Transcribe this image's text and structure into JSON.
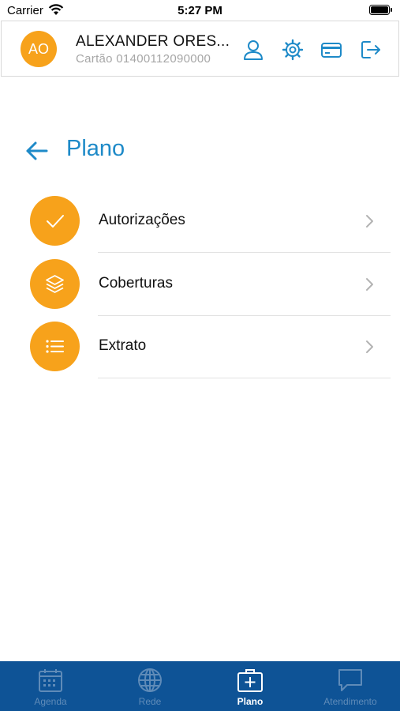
{
  "status_bar": {
    "carrier": "Carrier",
    "time": "5:27 PM"
  },
  "header": {
    "avatar_initials": "AO",
    "user_name": "ALEXANDER ORES...",
    "card_text": "Cartão 01400112090000",
    "icons": [
      "user-icon",
      "settings-icon",
      "card-icon",
      "logout-icon"
    ]
  },
  "page": {
    "title": "Plano"
  },
  "menu": [
    {
      "label": "Autorizações",
      "icon": "check-icon"
    },
    {
      "label": "Coberturas",
      "icon": "layers-icon"
    },
    {
      "label": "Extrato",
      "icon": "list-icon"
    }
  ],
  "tab_bar": {
    "tabs": [
      {
        "label": "Agenda",
        "icon": "calendar-icon"
      },
      {
        "label": "Rede",
        "icon": "globe-icon"
      },
      {
        "label": "Plano",
        "icon": "medical-case-icon"
      },
      {
        "label": "Atendimento",
        "icon": "chat-icon"
      }
    ],
    "active": "Plano"
  },
  "colors": {
    "accent": "#1e8ac8",
    "orange": "#f7a21b",
    "tab_bar": "#0e5396",
    "tab_inactive": "#5f8bb8"
  }
}
